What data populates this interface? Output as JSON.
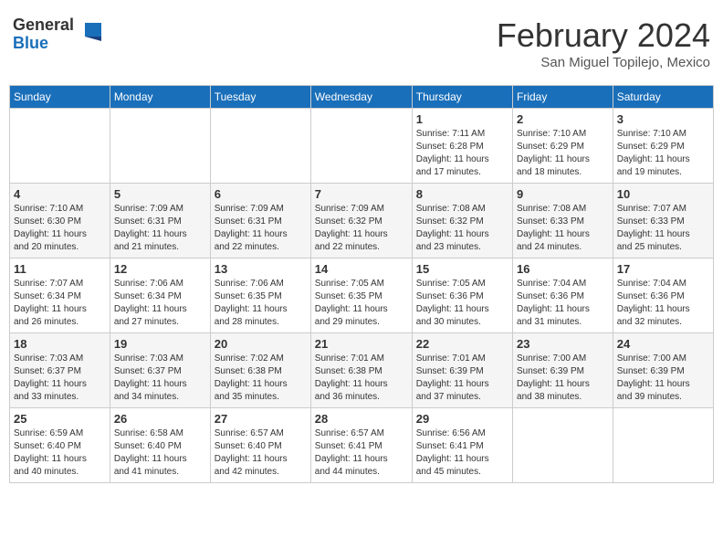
{
  "header": {
    "logo_general": "General",
    "logo_blue": "Blue",
    "month_title": "February 2024",
    "location": "San Miguel Topilejo, Mexico"
  },
  "days_of_week": [
    "Sunday",
    "Monday",
    "Tuesday",
    "Wednesday",
    "Thursday",
    "Friday",
    "Saturday"
  ],
  "weeks": [
    [
      {
        "day": "",
        "info": ""
      },
      {
        "day": "",
        "info": ""
      },
      {
        "day": "",
        "info": ""
      },
      {
        "day": "",
        "info": ""
      },
      {
        "day": "1",
        "info": "Sunrise: 7:11 AM\nSunset: 6:28 PM\nDaylight: 11 hours\nand 17 minutes."
      },
      {
        "day": "2",
        "info": "Sunrise: 7:10 AM\nSunset: 6:29 PM\nDaylight: 11 hours\nand 18 minutes."
      },
      {
        "day": "3",
        "info": "Sunrise: 7:10 AM\nSunset: 6:29 PM\nDaylight: 11 hours\nand 19 minutes."
      }
    ],
    [
      {
        "day": "4",
        "info": "Sunrise: 7:10 AM\nSunset: 6:30 PM\nDaylight: 11 hours\nand 20 minutes."
      },
      {
        "day": "5",
        "info": "Sunrise: 7:09 AM\nSunset: 6:31 PM\nDaylight: 11 hours\nand 21 minutes."
      },
      {
        "day": "6",
        "info": "Sunrise: 7:09 AM\nSunset: 6:31 PM\nDaylight: 11 hours\nand 22 minutes."
      },
      {
        "day": "7",
        "info": "Sunrise: 7:09 AM\nSunset: 6:32 PM\nDaylight: 11 hours\nand 22 minutes."
      },
      {
        "day": "8",
        "info": "Sunrise: 7:08 AM\nSunset: 6:32 PM\nDaylight: 11 hours\nand 23 minutes."
      },
      {
        "day": "9",
        "info": "Sunrise: 7:08 AM\nSunset: 6:33 PM\nDaylight: 11 hours\nand 24 minutes."
      },
      {
        "day": "10",
        "info": "Sunrise: 7:07 AM\nSunset: 6:33 PM\nDaylight: 11 hours\nand 25 minutes."
      }
    ],
    [
      {
        "day": "11",
        "info": "Sunrise: 7:07 AM\nSunset: 6:34 PM\nDaylight: 11 hours\nand 26 minutes."
      },
      {
        "day": "12",
        "info": "Sunrise: 7:06 AM\nSunset: 6:34 PM\nDaylight: 11 hours\nand 27 minutes."
      },
      {
        "day": "13",
        "info": "Sunrise: 7:06 AM\nSunset: 6:35 PM\nDaylight: 11 hours\nand 28 minutes."
      },
      {
        "day": "14",
        "info": "Sunrise: 7:05 AM\nSunset: 6:35 PM\nDaylight: 11 hours\nand 29 minutes."
      },
      {
        "day": "15",
        "info": "Sunrise: 7:05 AM\nSunset: 6:36 PM\nDaylight: 11 hours\nand 30 minutes."
      },
      {
        "day": "16",
        "info": "Sunrise: 7:04 AM\nSunset: 6:36 PM\nDaylight: 11 hours\nand 31 minutes."
      },
      {
        "day": "17",
        "info": "Sunrise: 7:04 AM\nSunset: 6:36 PM\nDaylight: 11 hours\nand 32 minutes."
      }
    ],
    [
      {
        "day": "18",
        "info": "Sunrise: 7:03 AM\nSunset: 6:37 PM\nDaylight: 11 hours\nand 33 minutes."
      },
      {
        "day": "19",
        "info": "Sunrise: 7:03 AM\nSunset: 6:37 PM\nDaylight: 11 hours\nand 34 minutes."
      },
      {
        "day": "20",
        "info": "Sunrise: 7:02 AM\nSunset: 6:38 PM\nDaylight: 11 hours\nand 35 minutes."
      },
      {
        "day": "21",
        "info": "Sunrise: 7:01 AM\nSunset: 6:38 PM\nDaylight: 11 hours\nand 36 minutes."
      },
      {
        "day": "22",
        "info": "Sunrise: 7:01 AM\nSunset: 6:39 PM\nDaylight: 11 hours\nand 37 minutes."
      },
      {
        "day": "23",
        "info": "Sunrise: 7:00 AM\nSunset: 6:39 PM\nDaylight: 11 hours\nand 38 minutes."
      },
      {
        "day": "24",
        "info": "Sunrise: 7:00 AM\nSunset: 6:39 PM\nDaylight: 11 hours\nand 39 minutes."
      }
    ],
    [
      {
        "day": "25",
        "info": "Sunrise: 6:59 AM\nSunset: 6:40 PM\nDaylight: 11 hours\nand 40 minutes."
      },
      {
        "day": "26",
        "info": "Sunrise: 6:58 AM\nSunset: 6:40 PM\nDaylight: 11 hours\nand 41 minutes."
      },
      {
        "day": "27",
        "info": "Sunrise: 6:57 AM\nSunset: 6:40 PM\nDaylight: 11 hours\nand 42 minutes."
      },
      {
        "day": "28",
        "info": "Sunrise: 6:57 AM\nSunset: 6:41 PM\nDaylight: 11 hours\nand 44 minutes."
      },
      {
        "day": "29",
        "info": "Sunrise: 6:56 AM\nSunset: 6:41 PM\nDaylight: 11 hours\nand 45 minutes."
      },
      {
        "day": "",
        "info": ""
      },
      {
        "day": "",
        "info": ""
      }
    ]
  ]
}
